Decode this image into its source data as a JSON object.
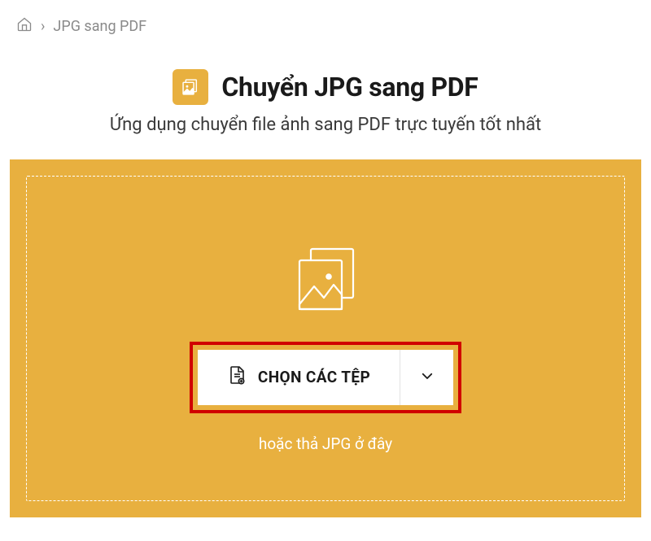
{
  "breadcrumb": {
    "separator": "›",
    "current": "JPG sang PDF"
  },
  "header": {
    "title": "Chuyển JPG sang PDF",
    "subtitle": "Ứng dụng chuyển file ảnh sang PDF trực tuyến tốt nhất"
  },
  "dropzone": {
    "button_label": "CHỌN CÁC TỆP",
    "hint": "hoặc thả JPG ở đây"
  },
  "colors": {
    "accent": "#e8b03f",
    "highlight": "#d00000"
  }
}
